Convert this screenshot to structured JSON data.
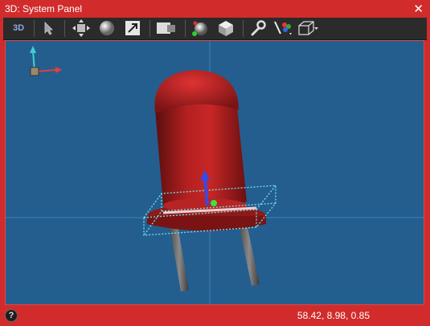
{
  "window": {
    "title": "3D: System Panel",
    "close_glyph": "✕"
  },
  "toolbar": {
    "view_3d_label": "3D",
    "tools": [
      "3d-view-toggle",
      "select-pointer",
      "move",
      "shade-sphere",
      "transform-arrow",
      "display-mode",
      "light-sphere",
      "material-cube",
      "settings-wrench",
      "paint-brush-colors",
      "bounding-box-dropdown"
    ]
  },
  "status": {
    "help_glyph": "?",
    "coordinates": "58.42, 8.98, 0.85"
  },
  "colors": {
    "frame": "#d22b2b",
    "viewport_bg": "#245e8f",
    "toolbar_bg": "#2b2b2b",
    "led_red": "#c42020"
  }
}
